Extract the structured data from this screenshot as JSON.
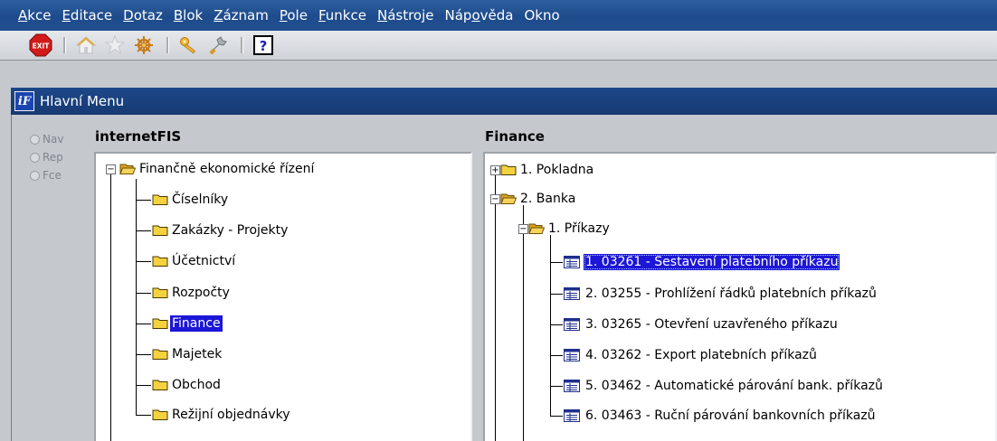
{
  "menubar": {
    "items": [
      {
        "pre": "",
        "u": "A",
        "post": "kce"
      },
      {
        "pre": "",
        "u": "E",
        "post": "ditace"
      },
      {
        "pre": "",
        "u": "D",
        "post": "otaz"
      },
      {
        "pre": "",
        "u": "B",
        "post": "lok"
      },
      {
        "pre": "",
        "u": "Z",
        "post": "áznam"
      },
      {
        "pre": "",
        "u": "P",
        "post": "ole"
      },
      {
        "pre": "",
        "u": "F",
        "post": "unkce"
      },
      {
        "pre": "",
        "u": "N",
        "post": "ástroje"
      },
      {
        "pre": "Náp",
        "u": "o",
        "post": "věda"
      },
      {
        "pre": "",
        "u": "",
        "post": "Okno"
      }
    ]
  },
  "toolbar": {
    "exit_label": "EXIT",
    "help_label": "?"
  },
  "window": {
    "logo": "iF",
    "title": "Hlavní Menu"
  },
  "radios": [
    "Nav",
    "Rep",
    "Fce"
  ],
  "left_panel": {
    "heading": "internetFIS",
    "root": "Finančně ekonomické řízení",
    "children": [
      "Číselníky",
      "Zakázky - Projekty",
      "Účetnictví",
      "Rozpočty",
      "Finance",
      "Majetek",
      "Obchod",
      "Režijní objednávky"
    ],
    "selected": "Finance"
  },
  "right_panel": {
    "heading": "Finance",
    "nodes": {
      "pokladna": "1. Pokladna",
      "banka": "2. Banka",
      "prikazy": "1. Příkazy"
    },
    "items": [
      "1. 03261 - Sestavení platebního příkazu",
      "2. 03255 - Prohlížení řádků platebních příkazů",
      "3. 03265 - Otevření uzavřeného příkazu",
      "4. 03262 - Export platebních příkazů",
      "5. 03462 - Automatické párování bank. příkazů",
      "6. 03463 - Ruční párování bankovních příkazů"
    ],
    "selected_index": 0
  }
}
